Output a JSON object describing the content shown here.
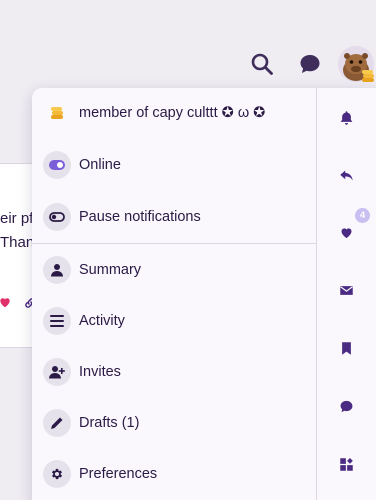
{
  "colors": {
    "accent": "#4a2a82",
    "pink": "#e0306a",
    "background": "#efecf2"
  },
  "header": {
    "search_icon": "search-icon",
    "chat_icon": "chat-bubble-icon",
    "avatar": "capybara-avatar"
  },
  "background_post": {
    "line1": "eir pfp",
    "line2": "Thank"
  },
  "menu": {
    "status": "member of capy culttt ✪ ω ✪",
    "items": [
      {
        "label": "Online",
        "icon": "toggle-on-icon"
      },
      {
        "label": "Pause notifications",
        "icon": "toggle-off-icon"
      },
      {
        "label": "Summary",
        "icon": "user-icon"
      },
      {
        "label": "Activity",
        "icon": "list-icon"
      },
      {
        "label": "Invites",
        "icon": "user-plus-icon"
      },
      {
        "label": "Drafts (1)",
        "icon": "pencil-icon"
      },
      {
        "label": "Preferences",
        "icon": "gear-icon"
      }
    ]
  },
  "quick_rail": {
    "items": [
      "bell-icon",
      "reply-icon",
      "heart-icon",
      "envelope-icon",
      "bookmark-icon",
      "chat-icon",
      "grid-plus-icon"
    ],
    "likes_badge": "4"
  }
}
